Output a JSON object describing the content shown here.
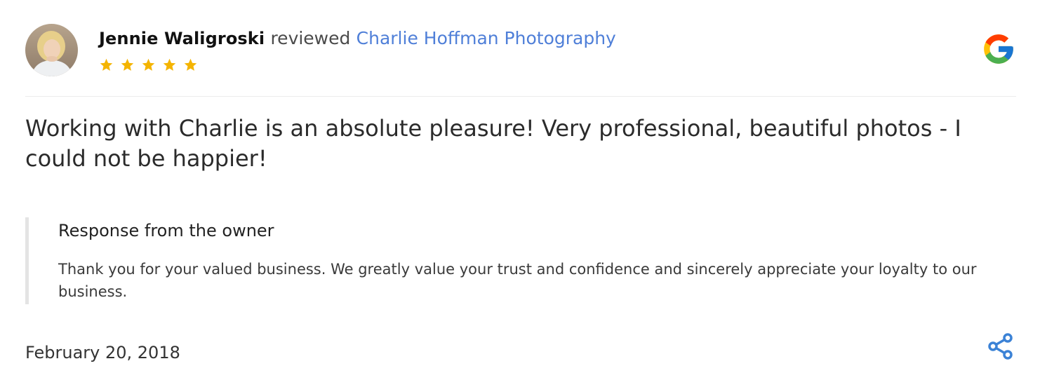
{
  "review": {
    "reviewer_name": "Jennie Waligroski",
    "reviewed_word": "reviewed",
    "business_name": "Charlie Hoffman Photography",
    "rating": 5,
    "rating_max": 5,
    "text": "Working with Charlie is an absolute pleasure! Very professional, beautiful photos - I could not be happier!",
    "date": "February 20, 2018"
  },
  "owner_response": {
    "title": "Response from the owner",
    "text": "Thank you for your valued business. We greatly value your trust and confidence and sincerely appreciate your loyalty to our business."
  },
  "icons": {
    "source_logo": "google-logo-icon",
    "star": "star-icon",
    "share": "share-icon"
  },
  "colors": {
    "link": "#4f7fd8",
    "star": "#f4b400",
    "share": "#3b82d6",
    "google_blue": "#4285F4",
    "google_green": "#34A853",
    "google_yellow": "#FBBC05",
    "google_red": "#EA4335"
  }
}
